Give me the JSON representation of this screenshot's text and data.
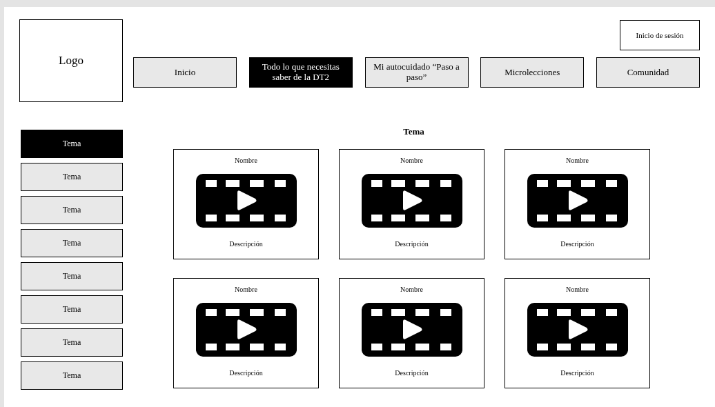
{
  "logo": "Logo",
  "login": "Inicio de sesión",
  "nav": [
    {
      "label": "Inicio",
      "selected": false
    },
    {
      "label": "Todo lo que necesitas saber de la DT2",
      "selected": true
    },
    {
      "label": "Mi autocuidado “Paso a paso”",
      "selected": false
    },
    {
      "label": "Microlecciones",
      "selected": false
    },
    {
      "label": "Comunidad",
      "selected": false
    }
  ],
  "sidebar": {
    "items": [
      {
        "label": "Tema",
        "selected": true
      },
      {
        "label": "Tema",
        "selected": false
      },
      {
        "label": "Tema",
        "selected": false
      },
      {
        "label": "Tema",
        "selected": false
      },
      {
        "label": "Tema",
        "selected": false
      },
      {
        "label": "Tema",
        "selected": false
      },
      {
        "label": "Tema",
        "selected": false
      },
      {
        "label": "Tema",
        "selected": false
      }
    ]
  },
  "heading": "Tema",
  "videos": [
    {
      "name": "Nombre",
      "description": "Descripción"
    },
    {
      "name": "Nombre",
      "description": "Descripción"
    },
    {
      "name": "Nombre",
      "description": "Descripción"
    },
    {
      "name": "Nombre",
      "description": "Descripción"
    },
    {
      "name": "Nombre",
      "description": "Descripción"
    },
    {
      "name": "Nombre",
      "description": "Descripción"
    }
  ]
}
